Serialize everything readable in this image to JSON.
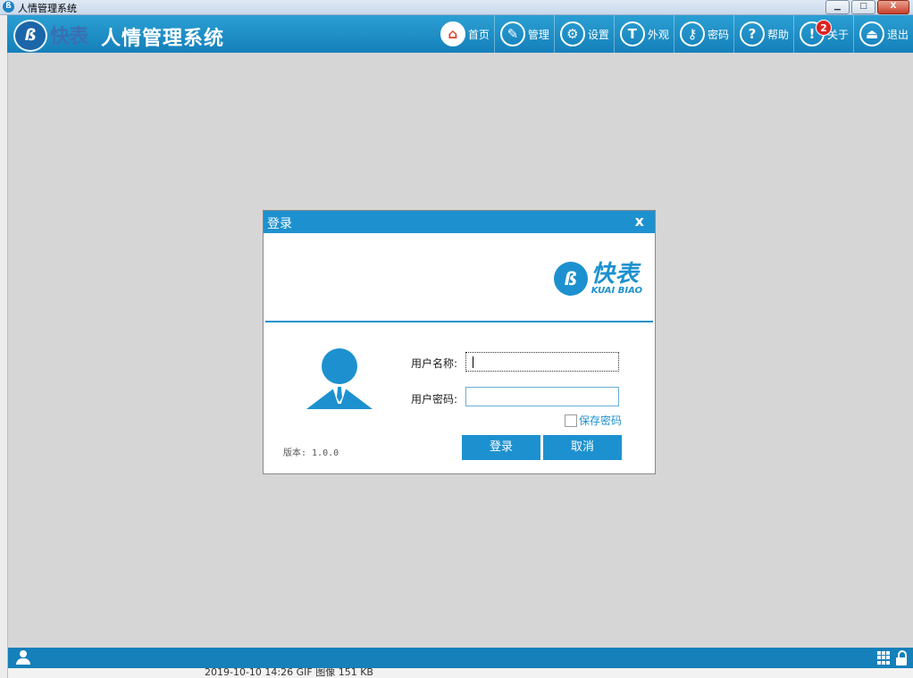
{
  "window": {
    "title": "人情管理系统",
    "minimize": "▁",
    "maximize": "□",
    "close": "X"
  },
  "header": {
    "logo_mark": "ß",
    "logo_text": "快表",
    "app_title": "人情管理系统",
    "nav": [
      {
        "label": "首页",
        "icon": "home-icon"
      },
      {
        "label": "管理",
        "icon": "manage-icon"
      },
      {
        "label": "设置",
        "icon": "gear-icon"
      },
      {
        "label": "外观",
        "icon": "tshirt-icon"
      },
      {
        "label": "密码",
        "icon": "key-icon"
      },
      {
        "label": "帮助",
        "icon": "help-icon"
      },
      {
        "label": "关于",
        "icon": "info-icon",
        "badge": "2"
      },
      {
        "label": "退出",
        "icon": "exit-icon"
      }
    ]
  },
  "login": {
    "title": "登录",
    "close": "x",
    "brand_cn": "快表",
    "brand_en": "KUAI BIAO",
    "username_label": "用户名称:",
    "username_value": "",
    "password_label": "用户密码:",
    "password_value": "",
    "save_password": "保存密码",
    "version": "版本: 1.0.0",
    "login_button": "登录",
    "cancel_button": "取消"
  },
  "colors": {
    "accent": "#1d91cf",
    "header": "#1580ba",
    "background": "#d6d6d6",
    "badge": "#dd2222"
  },
  "bottom_partial_text": "2019-10-10 14:26    GIF 图像    151 KB"
}
